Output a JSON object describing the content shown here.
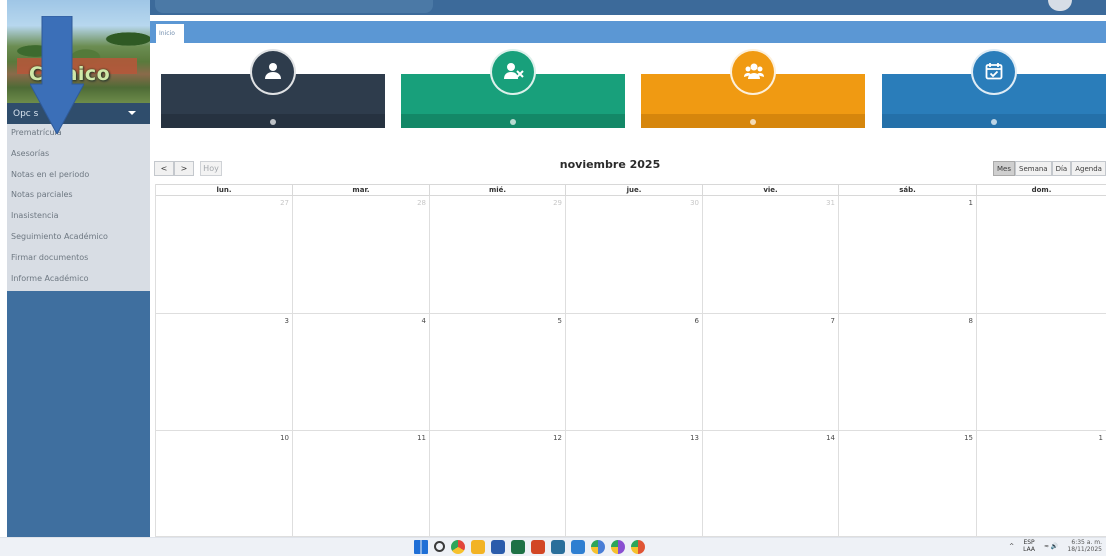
{
  "sidebar": {
    "brand": "C     naico",
    "options_label": "Opc     s",
    "menu": [
      {
        "label": "Prematrícula"
      },
      {
        "label": "Asesorías"
      },
      {
        "label": "Notas en el periodo"
      },
      {
        "label": "Notas parciales"
      },
      {
        "label": "Inasistencia"
      },
      {
        "label": "Seguimiento Académico"
      },
      {
        "label": "Firmar documentos"
      },
      {
        "label": "Informe Académico"
      }
    ]
  },
  "tabs": [
    {
      "label": "Inicio"
    }
  ],
  "cards": [
    {
      "icon": "user-icon",
      "color": "#2e3c4c",
      "bar": "#263240"
    },
    {
      "icon": "user-x-icon",
      "color": "#18a07b",
      "bar": "#138867"
    },
    {
      "icon": "group-icon",
      "color": "#f09a12",
      "bar": "#d6860c"
    },
    {
      "icon": "calendar-check-icon",
      "color": "#2a7dba",
      "bar": "#2470a9"
    }
  ],
  "calendar": {
    "title": "noviembre 2025",
    "prev_label": "<",
    "next_label": ">",
    "today_label": "Hoy",
    "views": [
      {
        "label": "Mes",
        "active": true
      },
      {
        "label": "Semana",
        "active": false
      },
      {
        "label": "Día",
        "active": false
      },
      {
        "label": "Agenda",
        "active": false
      }
    ],
    "weekdays": [
      "lun.",
      "mar.",
      "mié.",
      "jue.",
      "vie.",
      "sáb.",
      "dom."
    ],
    "weeks": [
      [
        {
          "d": "27",
          "other": true
        },
        {
          "d": "28",
          "other": true
        },
        {
          "d": "29",
          "other": true
        },
        {
          "d": "30",
          "other": true
        },
        {
          "d": "31",
          "other": true
        },
        {
          "d": "1",
          "other": false
        },
        {
          "d": "",
          "other": false
        }
      ],
      [
        {
          "d": "3",
          "other": false
        },
        {
          "d": "4",
          "other": false
        },
        {
          "d": "5",
          "other": false
        },
        {
          "d": "6",
          "other": false
        },
        {
          "d": "7",
          "other": false
        },
        {
          "d": "8",
          "other": false
        },
        {
          "d": "",
          "other": false
        }
      ],
      [
        {
          "d": "10",
          "other": false
        },
        {
          "d": "11",
          "other": false
        },
        {
          "d": "12",
          "other": false
        },
        {
          "d": "13",
          "other": false
        },
        {
          "d": "14",
          "other": false
        },
        {
          "d": "15",
          "other": false
        },
        {
          "d": "1",
          "other": false
        }
      ]
    ]
  },
  "taskbar": {
    "icons": [
      {
        "name": "windows-start-icon",
        "color": "#1f6fd6"
      },
      {
        "name": "search-icon",
        "color": "#3a3a3a"
      },
      {
        "name": "chrome-icon",
        "color": "#e2463b"
      },
      {
        "name": "file-explorer-icon",
        "color": "#f2b324"
      },
      {
        "name": "word-icon",
        "color": "#2b5cab"
      },
      {
        "name": "excel-icon",
        "color": "#1e7145"
      },
      {
        "name": "powerpoint-icon",
        "color": "#d24625"
      },
      {
        "name": "app-icon",
        "color": "#2a6f9b"
      },
      {
        "name": "shield-app-icon",
        "color": "#2f7fd1"
      },
      {
        "name": "chrome-profile-icon",
        "color": "#4a7ed6"
      },
      {
        "name": "chrome-profile-2-icon",
        "color": "#8a4fd1"
      },
      {
        "name": "chrome-profile-3-icon",
        "color": "#e05535"
      }
    ],
    "tray": {
      "chevron": "^",
      "lang_top": "ESP",
      "lang_bottom": "LAA",
      "status": "≈ 🔊",
      "time": "6:35 a. m.",
      "date": "18/11/2025"
    }
  }
}
